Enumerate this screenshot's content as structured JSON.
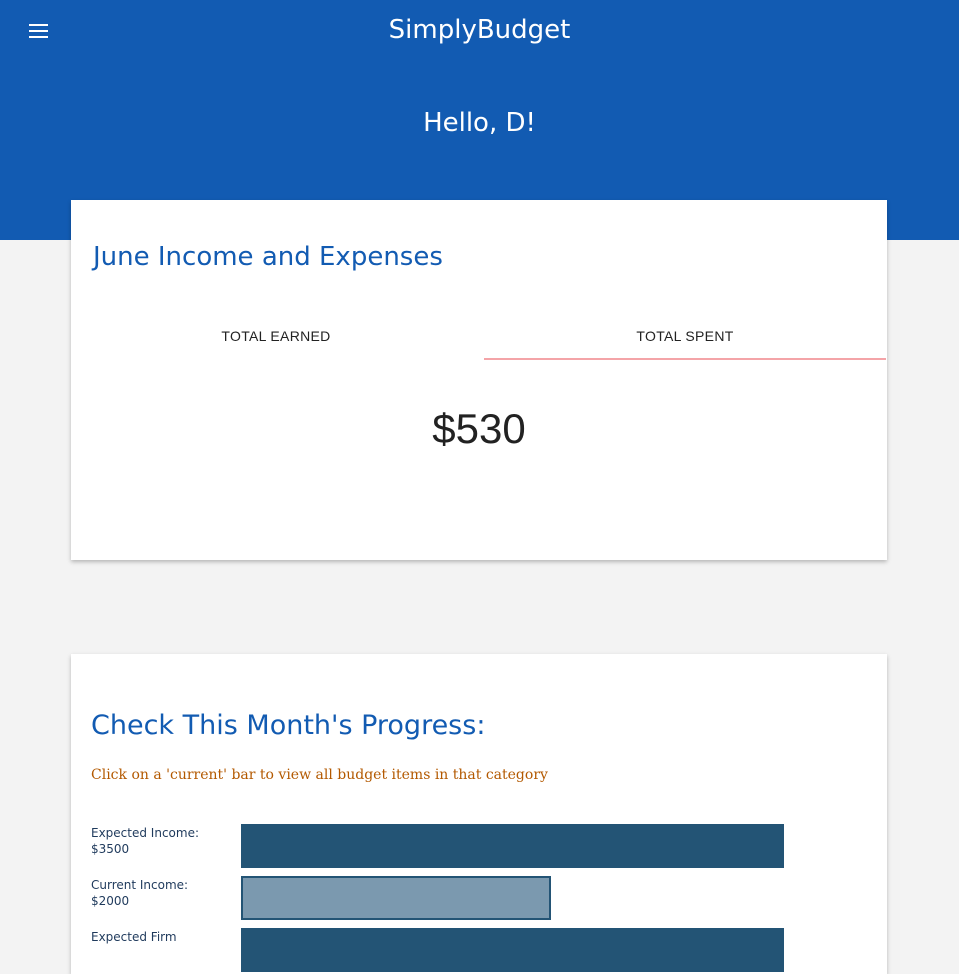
{
  "header": {
    "app_title": "SimplyBudget",
    "greeting": "Hello, D!",
    "menu_icon": "hamburger-menu-icon"
  },
  "summary_card": {
    "title": "June Income and Expenses",
    "tabs": [
      {
        "label": "TOTAL EARNED",
        "active": false
      },
      {
        "label": "TOTAL SPENT",
        "active": true
      }
    ],
    "amount": "$530",
    "active_tab_underline_color": "#f4a4a8"
  },
  "progress_card": {
    "title": "Check This Month's Progress:",
    "hint": "Click on a 'current' bar to view all budget items in that category",
    "bars": [
      {
        "label_line1": "Expected Income:",
        "label_line2": "$3500",
        "value": 3500,
        "kind": "expected"
      },
      {
        "label_line1": "Current Income:",
        "label_line2": "$2000",
        "value": 2000,
        "kind": "current"
      },
      {
        "label_line1": "Expected Firm",
        "label_line2": "",
        "value": 3500,
        "kind": "expected"
      }
    ],
    "max_value": 3500
  },
  "colors": {
    "brand_blue": "#125bb2",
    "bar_expected": "#235475",
    "bar_current": "#7b99af",
    "hint_text": "#b35900"
  }
}
